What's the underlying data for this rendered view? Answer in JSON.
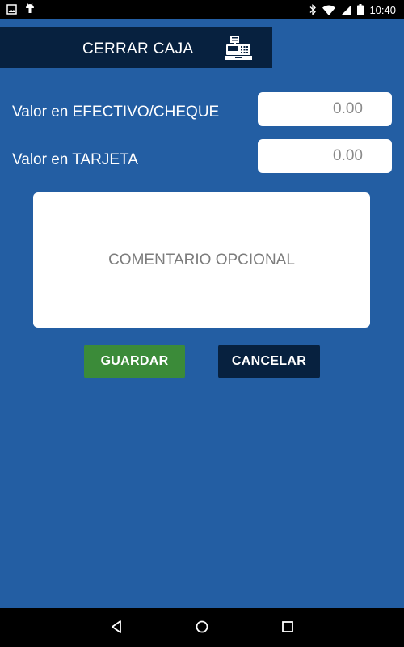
{
  "status_bar": {
    "time": "10:40",
    "icons": [
      "image-icon",
      "android-icon",
      "bluetooth-icon",
      "wifi-icon",
      "cell-signal-icon",
      "battery-icon"
    ]
  },
  "header": {
    "title": "CERRAR CAJA",
    "icon": "cash-register-icon"
  },
  "form": {
    "cash_label": "Valor en EFECTIVO/CHEQUE",
    "cash_value": "0.00",
    "card_label": "Valor en TARJETA",
    "card_value": "0.00",
    "comment_placeholder": "COMENTARIO OPCIONAL"
  },
  "buttons": {
    "save_label": "GUARDAR",
    "cancel_label": "CANCELAR"
  },
  "navigation": {
    "icons": [
      "back-icon",
      "home-icon",
      "recents-icon"
    ]
  },
  "colors": {
    "background": "#235ea3",
    "header": "#07213f",
    "save_button": "#3b8b39",
    "cancel_button": "#07213f"
  }
}
